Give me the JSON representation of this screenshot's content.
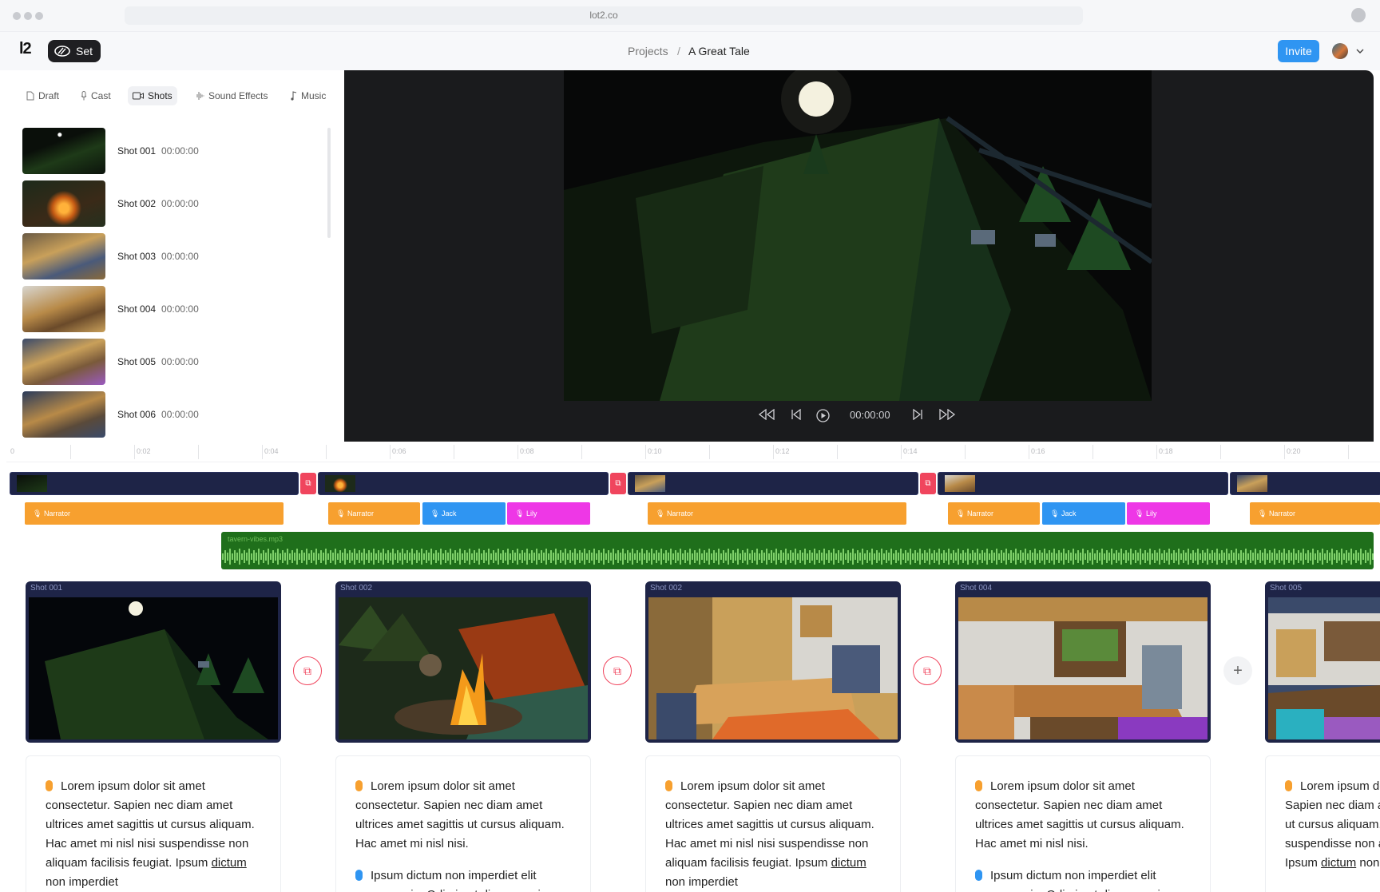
{
  "browser": {
    "url": "lot2.co"
  },
  "header": {
    "logo": "l2",
    "set_label": "Set",
    "breadcrumb_root": "Projects",
    "breadcrumb_sep": "/",
    "breadcrumb_current": "A Great Tale",
    "invite_label": "Invite"
  },
  "tabs": [
    {
      "label": "Draft",
      "icon": "document-icon"
    },
    {
      "label": "Cast",
      "icon": "microphone-icon"
    },
    {
      "label": "Shots",
      "icon": "camera-icon",
      "active": true
    },
    {
      "label": "Sound Effects",
      "icon": "waveform-icon"
    },
    {
      "label": "Music",
      "icon": "music-note-icon"
    }
  ],
  "shots": [
    {
      "name": "Shot 001",
      "time": "00:00:00"
    },
    {
      "name": "Shot 002",
      "time": "00:00:00"
    },
    {
      "name": "Shot 003",
      "time": "00:00:00"
    },
    {
      "name": "Shot 004",
      "time": "00:00:00"
    },
    {
      "name": "Shot 005",
      "time": "00:00:00"
    },
    {
      "name": "Shot 006",
      "time": "00:00:00"
    }
  ],
  "player": {
    "time": "00:00:00"
  },
  "ruler": [
    "0",
    "0:02",
    "0:04",
    "0:06",
    "0:08",
    "0:10",
    "0:12",
    "0:14",
    "0:16",
    "0:18",
    "0:20"
  ],
  "voice_tracks": {
    "narrator": "Narrator",
    "jack": "Jack",
    "lily": "Lily"
  },
  "music_track": {
    "file": "tavern-vibes.mp3"
  },
  "cards": [
    {
      "label": "Shot 001"
    },
    {
      "label": "Shot 002"
    },
    {
      "label": "Shot 002"
    },
    {
      "label": "Shot 004"
    },
    {
      "label": "Shot 005"
    }
  ],
  "script": {
    "p1_a": "Lorem ipsum dolor sit amet consectetur. Sapien nec diam amet ultrices amet sagittis ut cursus aliquam. Hac amet mi nisl nisi suspendisse non aliquam facilisis feugiat. Ipsum ",
    "p1_u": "dictum",
    "p1_b": " non imperdiet",
    "p2": "Lorem ipsum dolor sit amet consectetur. Sapien nec diam amet ultrices amet sagittis ut cursus aliquam. Hac amet mi nisl nisi.",
    "p3": "Ipsum dictum non imperdiet elit ornare proin. Odio in et diam mauris"
  },
  "colors": {
    "narrator": "#f7a02f",
    "jack": "#2f95f2",
    "lily": "#ee37e6",
    "transition": "#f0455d",
    "clip": "#1e2447",
    "music": "#1f6f1b"
  }
}
